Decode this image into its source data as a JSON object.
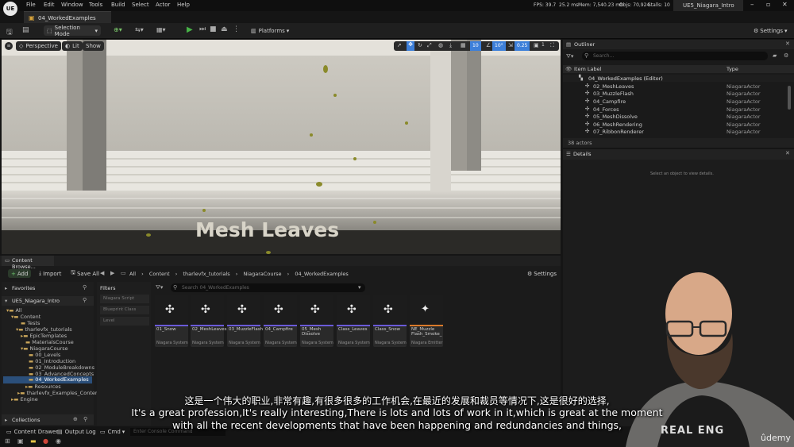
{
  "menu": {
    "logo": "UE",
    "items": [
      "File",
      "Edit",
      "Window",
      "Tools",
      "Build",
      "Select",
      "Actor",
      "Help"
    ],
    "stats": {
      "fps": "FPS: 39.7",
      "ms": "25.2 ms",
      "mem": "Mem: 7,540.23 mb",
      "objs": "Objs: 70,924",
      "stalls": "Stalls: 10"
    },
    "project": "UE5_Niagara_Intro"
  },
  "tab": {
    "label": "04_WorkedExamples"
  },
  "toolbar": {
    "mode": "Selection Mode",
    "platforms": "Platforms",
    "settings": "Settings"
  },
  "viewport": {
    "perspective": "Perspective",
    "lit": "Lit",
    "show": "Show",
    "snap_grid": "10",
    "snap_angle": "10°",
    "snap_scale": "0.25",
    "camera_speed": "1",
    "overlay_title": "Mesh Leaves"
  },
  "outliner": {
    "title": "Outliner",
    "search_placeholder": "Search...",
    "col_label": "Item Label",
    "col_type": "Type",
    "root": "04_WorkedExamples (Editor)",
    "rows": [
      {
        "label": "02_MeshLeaves",
        "type": "NiagaraActor"
      },
      {
        "label": "03_MuzzleFlash",
        "type": "NiagaraActor"
      },
      {
        "label": "04_Campfire",
        "type": "NiagaraActor"
      },
      {
        "label": "04_Forces",
        "type": "NiagaraActor"
      },
      {
        "label": "05_MeshDissolve",
        "type": "NiagaraActor"
      },
      {
        "label": "06_MeshRendering",
        "type": "NiagaraActor"
      },
      {
        "label": "07_RibbonRenderer",
        "type": "NiagaraActor"
      }
    ],
    "count": "38 actors"
  },
  "details": {
    "title": "Details",
    "empty": "Select an object to view details."
  },
  "content_browser": {
    "title": "Content Browse...",
    "add": "Add",
    "import": "Import",
    "save_all": "Save All",
    "breadcrumb": [
      "All",
      "Content",
      "tharlevfx_tutorials",
      "NiagaraCourse",
      "04_WorkedExamples"
    ],
    "settings": "Settings",
    "favorites": "Favorites",
    "project": "UE5_Niagara_Intro",
    "filters_label": "Filters",
    "filters": [
      "Niagara Script",
      "Blueprint Class",
      "Level"
    ],
    "search_placeholder": "Search 04_WorkedExamples",
    "collections": "Collections",
    "tree": [
      {
        "label": "All",
        "level": 0
      },
      {
        "label": "Content",
        "level": 1
      },
      {
        "label": "Tests",
        "level": 2
      },
      {
        "label": "tharlevfx_tutorials",
        "level": 2
      },
      {
        "label": "EpicTemplates",
        "level": 3
      },
      {
        "label": "MaterialsCourse",
        "level": 3
      },
      {
        "label": "NiagaraCourse",
        "level": 3
      },
      {
        "label": "00_Levels",
        "level": 4
      },
      {
        "label": "01_Introduction",
        "level": 4
      },
      {
        "label": "02_ModuleBreakdowns",
        "level": 4
      },
      {
        "label": "03_AdvancedConcepts",
        "level": 4
      },
      {
        "label": "04_WorkedExamples",
        "level": 4
      },
      {
        "label": "Resources",
        "level": 3
      },
      {
        "label": "tharlevfx_Examples_Conten",
        "level": 2
      },
      {
        "label": "Engine",
        "level": 1
      }
    ],
    "assets": [
      {
        "name": "01_Snow",
        "kind": "Niagara System"
      },
      {
        "name": "02_MeshLeaves",
        "kind": "Niagara System"
      },
      {
        "name": "03_MuzzleFlash",
        "kind": "Niagara System"
      },
      {
        "name": "04_Campfire",
        "kind": "Niagara System"
      },
      {
        "name": "05_Mesh Dissolve",
        "kind": "Niagara System"
      },
      {
        "name": "Class_Leaves",
        "kind": "Niagara System"
      },
      {
        "name": "Class_Snow",
        "kind": "Niagara System"
      },
      {
        "name": "NE_Muzzle Flash_Smoke_",
        "kind": "Niagara Emitter"
      }
    ]
  },
  "bottom": {
    "content_drawer": "Content Drawer",
    "output_log": "Output Log",
    "cmd": "Cmd",
    "console_placeholder": "Enter Console Command"
  },
  "subtitles": {
    "zh": "这是一个伟大的职业,非常有趣,有很多很多的工作机会,在最近的发展和裁员等情况下,这是很好的选择,",
    "en1": "It's a great profession,It's really interesting,There is lots and lots of work in it,which is great at the moment",
    "en2": "with all the recent developments that have been happening and redundancies and things,"
  },
  "watermark": {
    "udemy": "ûdemy",
    "shirt": "REAL ENG"
  },
  "colors": {
    "accent": "#3d7fd9",
    "selected": "#2b4f7a",
    "play": "#47b247",
    "emitter": "#d97a2b",
    "system": "#6a5ad8"
  }
}
